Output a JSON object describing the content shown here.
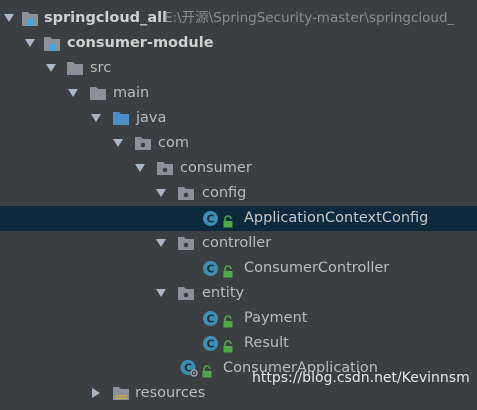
{
  "project": {
    "name": "springcloud_all",
    "path": "E:\\开源\\SpringSecurity-master\\springcloud_"
  },
  "tree": {
    "module": "consumer-module",
    "src": "src",
    "main": "main",
    "java": "java",
    "com": "com",
    "consumer": "consumer",
    "config": "config",
    "application_context_config": "ApplicationContextConfig",
    "controller": "controller",
    "consumer_controller": "ConsumerController",
    "entity": "entity",
    "payment": "Payment",
    "result": "Result",
    "consumer_application": "ConsumerApplication",
    "resources": "resources"
  },
  "watermark": "https://blog.csdn.net/Kevinnsm",
  "colors": {
    "background": "#3c3f41",
    "selection": "#0d293e",
    "class_icon": "#3d8fb3",
    "folder": "#8a9199",
    "source_folder": "#4a8ec8",
    "lock": "#4fa84a",
    "module_accent": "#40a8e0"
  },
  "icons": {
    "expanded": "triangle-down-icon",
    "collapsed": "triangle-right-icon",
    "module": "module-icon",
    "folder": "folder-icon",
    "source_folder": "source-folder-icon",
    "package": "package-icon",
    "class": "class-icon",
    "spring_boot_class": "spring-boot-class-icon",
    "access": "lock-icon"
  }
}
